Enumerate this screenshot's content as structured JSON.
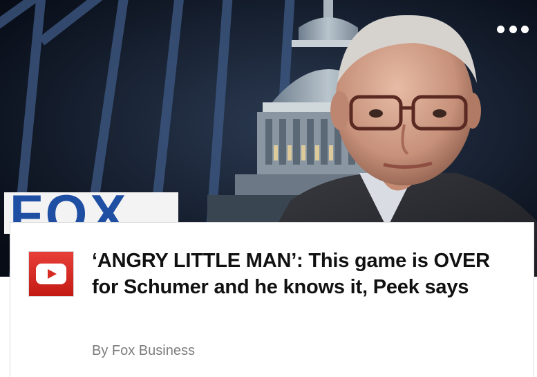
{
  "hero": {
    "logo_text": "FOX",
    "more_icon": "more-horizontal-icon"
  },
  "article": {
    "source_icon": "youtube-icon",
    "headline": "‘ANGRY LITTLE MAN’: This game is OVER for Schumer and he knows it, Peek says",
    "byline": "By Fox Business"
  },
  "colors": {
    "source_icon_red": "#d62a22",
    "headline": "#111111",
    "byline": "#7c7c7c"
  }
}
